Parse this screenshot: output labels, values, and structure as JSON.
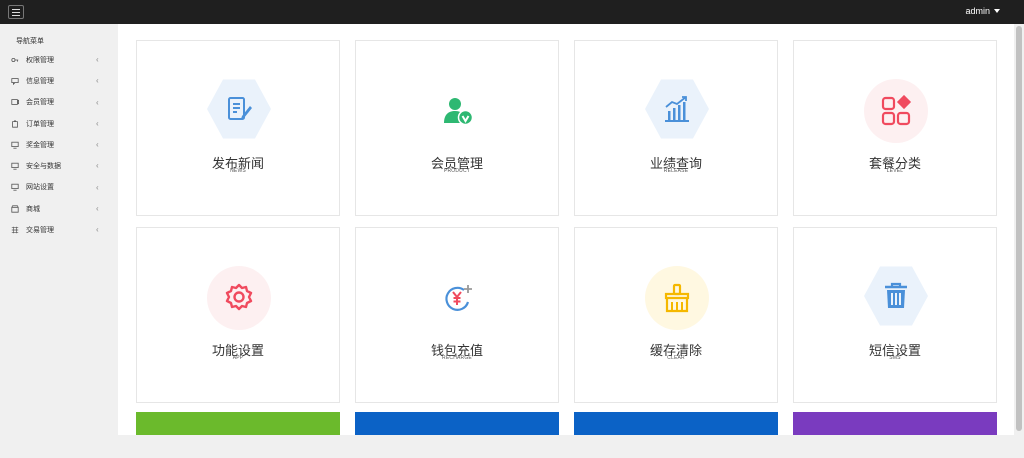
{
  "topbar": {
    "user_label": "admin"
  },
  "sidebar": {
    "title": "导航菜单",
    "items": [
      {
        "label": "权限管理",
        "icon": "key-icon"
      },
      {
        "label": "信息管理",
        "icon": "message-icon"
      },
      {
        "label": "会员管理",
        "icon": "member-icon"
      },
      {
        "label": "订单管理",
        "icon": "order-icon"
      },
      {
        "label": "奖金管理",
        "icon": "monitor-icon"
      },
      {
        "label": "安全与数据",
        "icon": "shield-icon"
      },
      {
        "label": "网站设置",
        "icon": "monitor-icon"
      },
      {
        "label": "商城",
        "icon": "shop-icon"
      },
      {
        "label": "交易管理",
        "icon": "grid-icon"
      }
    ]
  },
  "cards": [
    {
      "title": "发布新闻",
      "subtitle": "NEWS",
      "icon": "edit-document-icon",
      "color": "#4a90d9",
      "bg": "#eaf2fb"
    },
    {
      "title": "会员管理",
      "subtitle": "PRODUCT",
      "icon": "verified-user-icon",
      "color": "#2eb872",
      "bg": "#ffffff"
    },
    {
      "title": "业绩查询",
      "subtitle": "RELEASE",
      "icon": "bar-chart-icon",
      "color": "#4a90d9",
      "bg": "#eaf2fb"
    },
    {
      "title": "套餐分类",
      "subtitle": "LEVEL",
      "icon": "category-icon",
      "color": "#f04a5e",
      "bg": "#fdf0f1"
    },
    {
      "title": "功能设置",
      "subtitle": "APP",
      "icon": "settings-gear-icon",
      "color": "#f04a5e",
      "bg": "#fdf0f1"
    },
    {
      "title": "钱包充值",
      "subtitle": "RECHARGE",
      "icon": "wallet-recharge-icon",
      "color": "#4a90d9",
      "bg": "#ffffff"
    },
    {
      "title": "缓存清除",
      "subtitle": "CLEAR",
      "icon": "broom-icon",
      "color": "#f5b800",
      "bg": "#fff8e1"
    },
    {
      "title": "短信设置",
      "subtitle": "SMS",
      "icon": "trash-icon",
      "color": "#4a90d9",
      "bg": "#eaf2fb"
    }
  ],
  "strips": [
    "#6bba2c",
    "#0b62c6",
    "#0b62c6",
    "#7a3bbf"
  ]
}
